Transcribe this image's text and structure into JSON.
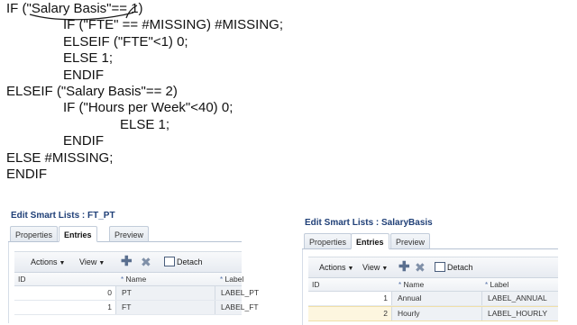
{
  "code": {
    "lines": [
      "IF (\"Salary Basis\"== 1)",
      "IF (\"FTE\" == #MISSING) #MISSING;",
      "ELSEIF (\"FTE\"<1) 0;",
      "ELSE 1;",
      "ENDIF",
      "ELSEIF (\"Salary Basis\"== 2)",
      "IF (\"Hours per Week\"<40) 0;",
      "ELSE 1;",
      "ENDIF",
      "ELSE #MISSING;",
      "ENDIF"
    ]
  },
  "panels": [
    {
      "title": "Edit Smart Lists : FT_PT",
      "tabs": [
        "Properties",
        "Entries",
        "Preview"
      ],
      "active_tab": "Entries",
      "toolbar": {
        "actions": "Actions",
        "view": "View",
        "detach": "Detach"
      },
      "columns": {
        "id": "ID",
        "name": "Name",
        "label": "Label"
      },
      "rows": [
        {
          "id": "0",
          "name": "PT",
          "label": "LABEL_PT"
        },
        {
          "id": "1",
          "name": "FT",
          "label": "LABEL_FT"
        }
      ]
    },
    {
      "title": "Edit Smart Lists : SalaryBasis",
      "tabs": [
        "Properties",
        "Entries",
        "Preview"
      ],
      "active_tab": "Entries",
      "toolbar": {
        "actions": "Actions",
        "view": "View",
        "detach": "Detach"
      },
      "columns": {
        "id": "ID",
        "name": "Name",
        "label": "Label"
      },
      "rows": [
        {
          "id": "1",
          "name": "Annual",
          "label": "LABEL_ANNUAL"
        },
        {
          "id": "2",
          "name": "Hourly",
          "label": "LABEL_HOURLY"
        }
      ]
    }
  ],
  "icons": {
    "add": "plus-icon",
    "delete": "x-icon",
    "detach": "detach-icon",
    "required": "asterisk-icon"
  },
  "colors": {
    "title": "#1f3f77",
    "selected_row": "#fdf6df"
  }
}
